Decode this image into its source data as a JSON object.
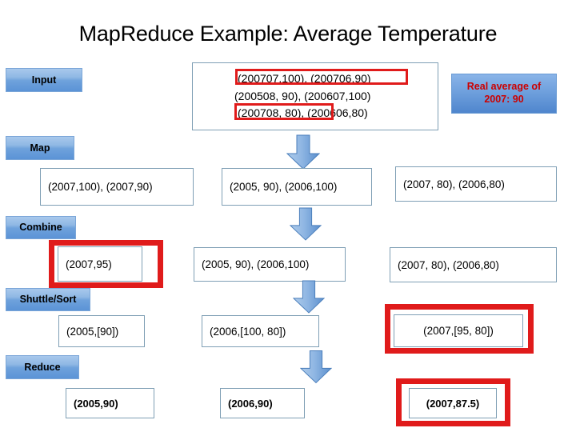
{
  "slide": {
    "title": "MapReduce Example: Average Temperature",
    "background_color": "#ffffff",
    "accent_blue": "#5b93d6",
    "highlight_red": "#e01b1b",
    "box_border": "#7f9fb5"
  },
  "stages": [
    {
      "id": "input",
      "label": "Input"
    },
    {
      "id": "map",
      "label": "Map"
    },
    {
      "id": "combine",
      "label": "Combine"
    },
    {
      "id": "shuttle_sort",
      "label": "Shuttle/Sort"
    },
    {
      "id": "reduce",
      "label": "Reduce"
    }
  ],
  "input_rows": [
    {
      "text": "(200707,100), (200706,90)",
      "highlighted": "full"
    },
    {
      "text": "(200508, 90), (200607,100)",
      "highlighted": "none"
    },
    {
      "text": "(200708, 80), (200606,80)",
      "highlighted": "partial"
    }
  ],
  "callout": {
    "line1": "Real average of",
    "line2": "2007: 90",
    "text_color": "#cc0000"
  },
  "map_row": [
    {
      "text": "(2007,100), (2007,90)",
      "highlighted": false
    },
    {
      "text": "(2005, 90), (2006,100)",
      "highlighted": false
    },
    {
      "text": "(2007, 80), (2006,80)",
      "highlighted": false
    }
  ],
  "combine_row": [
    {
      "text": "(2007,95)",
      "highlighted": true
    },
    {
      "text": "(2005, 90), (2006,100)",
      "highlighted": false
    },
    {
      "text": "(2007, 80), (2006,80)",
      "highlighted": false
    }
  ],
  "shuttle_sort_row": [
    {
      "text": "(2005,[90])",
      "highlighted": false
    },
    {
      "text": "(2006,[100, 80])",
      "highlighted": false
    },
    {
      "text": "(2007,[95, 80])",
      "highlighted": true
    }
  ],
  "reduce_row": [
    {
      "text": "(2005,90)",
      "highlighted": false
    },
    {
      "text": "(2006,90)",
      "highlighted": false
    },
    {
      "text": "(2007,87.5)",
      "highlighted": true
    }
  ],
  "arrows": [
    {
      "id": "arrow-input-to-map",
      "direction": "down"
    },
    {
      "id": "arrow-map-to-combine",
      "direction": "down"
    },
    {
      "id": "arrow-combine-to-shuttle",
      "direction": "down"
    },
    {
      "id": "arrow-shuttle-to-reduce",
      "direction": "down"
    }
  ]
}
